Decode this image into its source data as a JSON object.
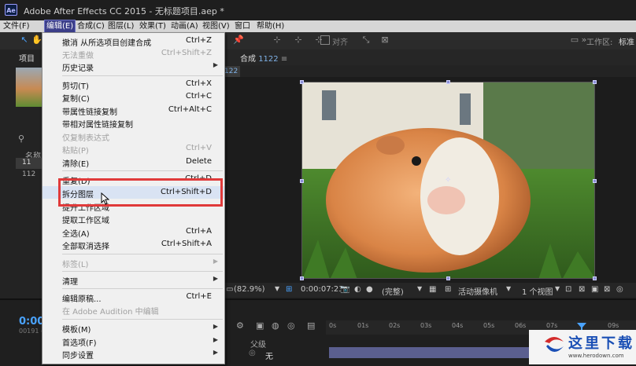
{
  "window": {
    "title": "Adobe After Effects CC 2015 - 无标题项目.aep *",
    "logo_text": "Ae"
  },
  "menubar": {
    "items": [
      "文件(F)",
      "编辑(E)",
      "合成(C)",
      "图层(L)",
      "效果(T)",
      "动画(A)",
      "视图(V)",
      "窗口",
      "帮助(H)"
    ]
  },
  "toolbar": {
    "snap_label": "对齐",
    "workspace_label": "工作区:",
    "workspace_value": "标准"
  },
  "project_panel": {
    "tab_label": "项目",
    "column_name": "名称",
    "row1": "11",
    "row2": "112"
  },
  "composition": {
    "tab_label": "合成",
    "tab_name": "1122",
    "sub_tab": "122"
  },
  "viewer_controls": {
    "zoom": "(82.9%)",
    "timecode": "0:00:07:23",
    "quality": "(完整)",
    "camera": "活动摄像机",
    "views": "1 个视图"
  },
  "timeline": {
    "current_time": "0:00:",
    "frames": "00191 (2",
    "parent_label": "父级",
    "parent_value": "无",
    "ruler_ticks": [
      "0s",
      "01s",
      "02s",
      "03s",
      "04s",
      "05s",
      "06s",
      "07s",
      "09s"
    ]
  },
  "edit_menu": {
    "items": [
      {
        "label": "撤消 从所选项目创建合成",
        "shortcut": "Ctrl+Z",
        "disabled": false
      },
      {
        "label": "无法重做",
        "shortcut": "Ctrl+Shift+Z",
        "disabled": true
      },
      {
        "label": "历史记录",
        "shortcut": "",
        "disabled": false,
        "submenu": true
      },
      {
        "label": "剪切(T)",
        "shortcut": "Ctrl+X",
        "disabled": false
      },
      {
        "label": "复制(C)",
        "shortcut": "Ctrl+C",
        "disabled": false
      },
      {
        "label": "带属性链接复制",
        "shortcut": "Ctrl+Alt+C",
        "disabled": false
      },
      {
        "label": "带相对属性链接复制",
        "shortcut": "",
        "disabled": false
      },
      {
        "label": "仅复制表达式",
        "shortcut": "",
        "disabled": true
      },
      {
        "label": "粘贴(P)",
        "shortcut": "Ctrl+V",
        "disabled": true
      },
      {
        "label": "清除(E)",
        "shortcut": "Delete",
        "disabled": false
      },
      {
        "label": "重复(D)",
        "shortcut": "Ctrl+D",
        "disabled": false
      },
      {
        "label": "拆分图层",
        "shortcut": "Ctrl+Shift+D",
        "disabled": false
      },
      {
        "label": "提升工作区域",
        "shortcut": "",
        "disabled": false
      },
      {
        "label": "提取工作区域",
        "shortcut": "",
        "disabled": false
      },
      {
        "label": "全选(A)",
        "shortcut": "Ctrl+A",
        "disabled": false
      },
      {
        "label": "全部取消选择",
        "shortcut": "Ctrl+Shift+A",
        "disabled": false
      },
      {
        "label": "标签(L)",
        "shortcut": "",
        "disabled": true,
        "submenu": true
      },
      {
        "label": "清理",
        "shortcut": "",
        "disabled": false,
        "submenu": true
      },
      {
        "label": "编辑原稿...",
        "shortcut": "Ctrl+E",
        "disabled": false
      },
      {
        "label": "在 Adobe Audition 中编辑",
        "shortcut": "",
        "disabled": true
      },
      {
        "label": "模板(M)",
        "shortcut": "",
        "disabled": false,
        "submenu": true
      },
      {
        "label": "首选项(F)",
        "shortcut": "",
        "disabled": false,
        "submenu": true
      },
      {
        "label": "同步设置",
        "shortcut": "",
        "disabled": false,
        "submenu": true
      }
    ]
  },
  "watermark": {
    "text": "这里下载",
    "url": "www.herodown.com"
  },
  "colors": {
    "accent": "#4aa3ff",
    "highlight_box": "#e03a3a",
    "menu_bg": "#f0f0f0"
  }
}
